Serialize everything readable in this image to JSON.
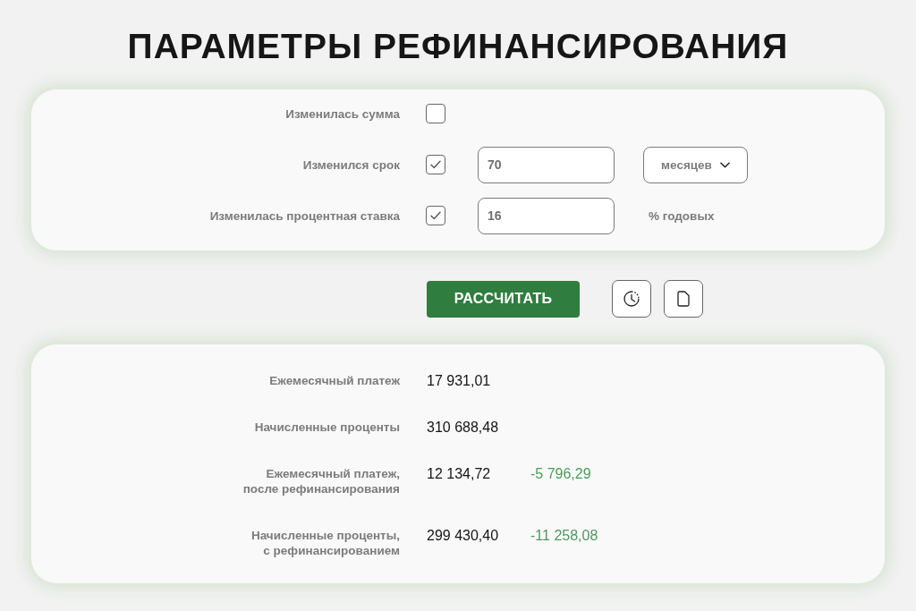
{
  "title": "ПАРАМЕТРЫ РЕФИНАНСИРОВАНИЯ",
  "parameters": {
    "rows": [
      {
        "kind": "plain",
        "label": "Изменилась сумма",
        "checked": false
      },
      {
        "kind": "with_dropdown",
        "label": "Изменился срок",
        "checked": true,
        "value": "70",
        "dropdown": "месяцев"
      },
      {
        "kind": "with_unit",
        "label": "Изменилась процентная ставка",
        "checked": true,
        "value": "16",
        "unit": "% годовых"
      }
    ]
  },
  "actions": {
    "calculate_button": "РАССЧИТАТЬ"
  },
  "results": {
    "rows": [
      {
        "label": "Ежемесячный платеж",
        "value": "17 931,01"
      },
      {
        "label": "Начисленные проценты",
        "value": "310 688,48"
      },
      {
        "label": "Ежемесячный платеж,\nпосле рефинансирования",
        "value": "12 134,72",
        "difference": "-5 796,29"
      },
      {
        "label": "Начисленные проценты,\nс рефинансированием",
        "value": "299 430,40",
        "difference": "-11 258,08"
      }
    ]
  }
}
